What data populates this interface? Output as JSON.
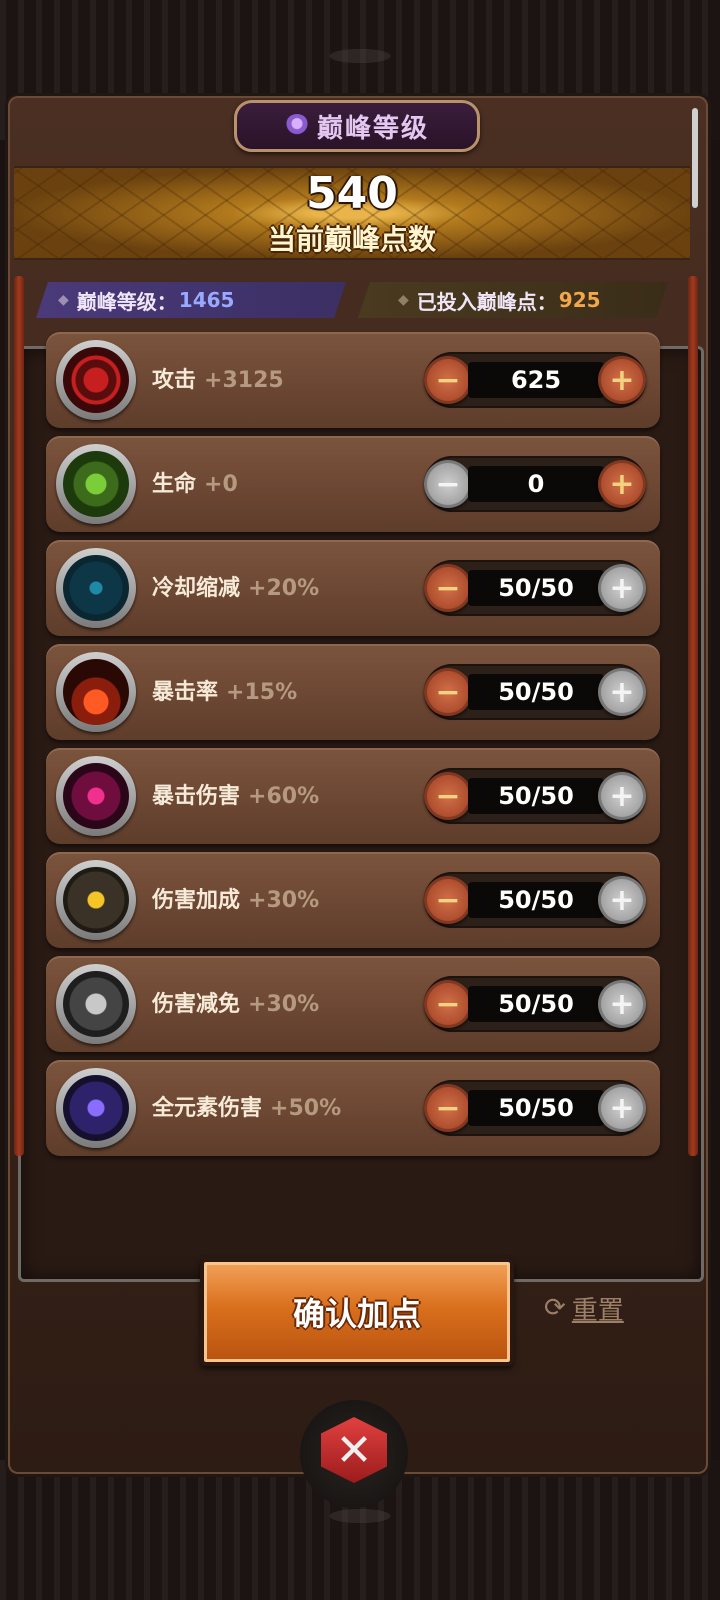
{
  "header": {
    "title": "巅峰等级",
    "points_value": "540",
    "points_label": "当前巅峰点数"
  },
  "info": {
    "level_label": "巅峰等级：",
    "level_value": "1465",
    "invested_label": "已投入巅峰点：",
    "invested_value": "925"
  },
  "stats": [
    {
      "name": "攻击",
      "bonus": "+3125",
      "value": "625",
      "icon": "attack-icon",
      "minus_enabled": true,
      "plus_enabled": true
    },
    {
      "name": "生命",
      "bonus": "+0",
      "value": "0",
      "icon": "life-icon",
      "minus_enabled": false,
      "plus_enabled": true
    },
    {
      "name": "冷却缩减",
      "bonus": "+20%",
      "value": "50/50",
      "icon": "cooldown-icon",
      "minus_enabled": true,
      "plus_enabled": false
    },
    {
      "name": "暴击率",
      "bonus": "+15%",
      "value": "50/50",
      "icon": "crit-rate-icon",
      "minus_enabled": true,
      "plus_enabled": false
    },
    {
      "name": "暴击伤害",
      "bonus": "+60%",
      "value": "50/50",
      "icon": "crit-damage-icon",
      "minus_enabled": true,
      "plus_enabled": false
    },
    {
      "name": "伤害加成",
      "bonus": "+30%",
      "value": "50/50",
      "icon": "damage-bonus-icon",
      "minus_enabled": true,
      "plus_enabled": false
    },
    {
      "name": "伤害减免",
      "bonus": "+30%",
      "value": "50/50",
      "icon": "damage-reduction-icon",
      "minus_enabled": true,
      "plus_enabled": false
    },
    {
      "name": "全元素伤害",
      "bonus": "+50%",
      "value": "50/50",
      "icon": "element-damage-icon",
      "minus_enabled": true,
      "plus_enabled": false
    }
  ],
  "actions": {
    "confirm_label": "确认加点",
    "reset_label": "重置"
  },
  "colors": {
    "accent_orange": "#d9701d",
    "level_blue": "#9aa8ff",
    "invested_orange": "#f2a84a"
  }
}
